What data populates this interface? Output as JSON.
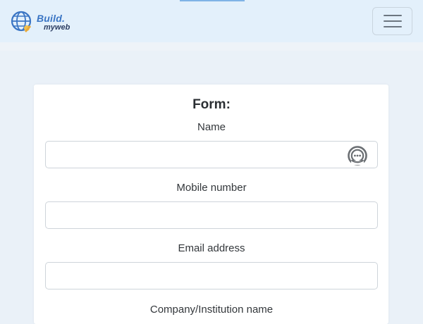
{
  "header": {
    "brand_top": "Build.",
    "brand_bottom": "myweb",
    "logo_icon": "globe-icon",
    "menu_icon": "hamburger-icon"
  },
  "form": {
    "title": "Form:",
    "fields": [
      {
        "label": "Name",
        "value": "",
        "placeholder": "",
        "icon": "password-manager-icon"
      },
      {
        "label": "Mobile number",
        "value": "",
        "placeholder": ""
      },
      {
        "label": "Email address",
        "value": "",
        "placeholder": ""
      },
      {
        "label": "Company/Institution name"
      }
    ]
  },
  "colors": {
    "navbar_bg": "#e3f0fb",
    "page_bg": "#eaf1f8",
    "brand_blue": "#3a75c4",
    "brand_dark": "#2c3e63",
    "input_border": "#ced4da"
  }
}
